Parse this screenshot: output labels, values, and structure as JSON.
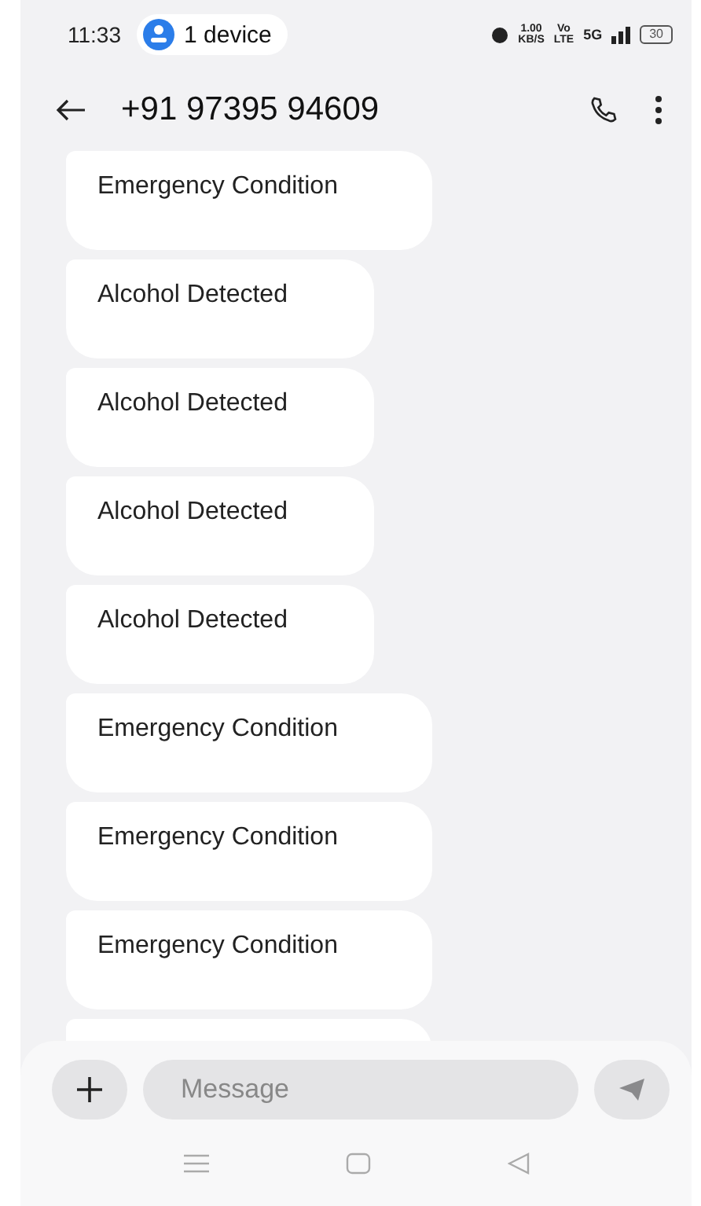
{
  "status_bar": {
    "time": "11:33",
    "pill": "1 device",
    "speed_value": "1.00",
    "speed_unit": "KB/S",
    "volte_top": "Vo",
    "volte_bottom": "LTE",
    "network": "5G",
    "battery": "30"
  },
  "header": {
    "title": "+91 97395 94609"
  },
  "messages": [
    {
      "text": "Emergency Condition"
    },
    {
      "text": "Alcohol Detected"
    },
    {
      "text": "Alcohol Detected"
    },
    {
      "text": "Alcohol Detected"
    },
    {
      "text": "Alcohol Detected"
    },
    {
      "text": "Emergency Condition"
    },
    {
      "text": "Emergency Condition"
    },
    {
      "text": "Emergency Condition"
    }
  ],
  "composer": {
    "placeholder": "Message"
  }
}
